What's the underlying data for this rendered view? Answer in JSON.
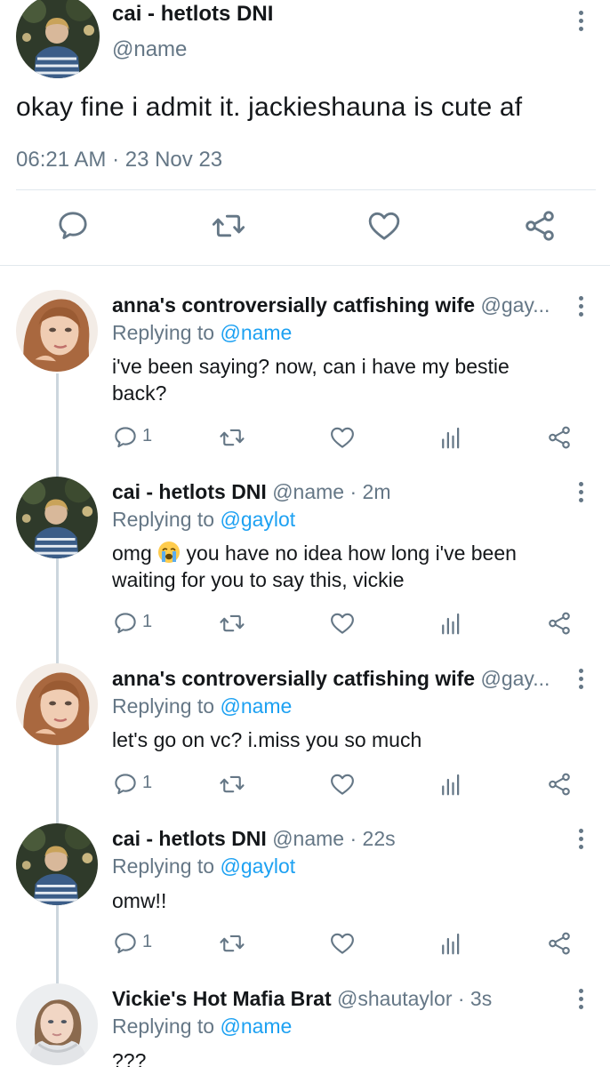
{
  "main_tweet": {
    "name": "cai - hetlots DNI",
    "handle": "@name",
    "text": "okay fine i admit it. jackieshauna is cute af",
    "meta": "06:21 AM · 23 Nov 23"
  },
  "replies": [
    {
      "name": "anna's controversially catfishing wife",
      "handle": "@gay...",
      "replying_prefix": "Replying to ",
      "replying_to": "@name",
      "line1": "i've been saying? now, can i have my bestie",
      "line2": "back?",
      "reply_count": "1"
    },
    {
      "name": "cai - hetlots DNI",
      "handle": "@name · 2m",
      "replying_prefix": "Replying to ",
      "replying_to": "@gaylot",
      "line1_pre": "omg ",
      "line1_post": " you have no idea how long i've been",
      "line2": "waiting for you to say this, vickie",
      "reply_count": "1"
    },
    {
      "name": "anna's controversially catfishing wife",
      "handle": "@gay...",
      "replying_prefix": "Replying to ",
      "replying_to": "@name",
      "line1": "let's go on vc? i.miss you so much",
      "reply_count": "1"
    },
    {
      "name": "cai - hetlots DNI",
      "handle": "@name · 22s",
      "replying_prefix": "Replying to ",
      "replying_to": "@gaylot",
      "line1": "omw!!",
      "reply_count": "1"
    },
    {
      "name": "Vickie's Hot Mafia Brat",
      "handle": "@shautaylor · 3s",
      "replying_prefix": "Replying to ",
      "replying_to": "@name",
      "line1": "???"
    }
  ],
  "icons": {
    "reply": "reply-icon",
    "retweet": "retweet-icon",
    "like": "heart-icon",
    "analytics": "analytics-icon",
    "share": "share-icon",
    "more": "more-options-icon",
    "crying_emoji": "crying-face-emoji"
  },
  "colors": {
    "text": "#14171a",
    "secondary": "#657786",
    "accent": "#1da1f2",
    "divider": "#e1e8ed",
    "thread_line": "#ccd6dd"
  }
}
